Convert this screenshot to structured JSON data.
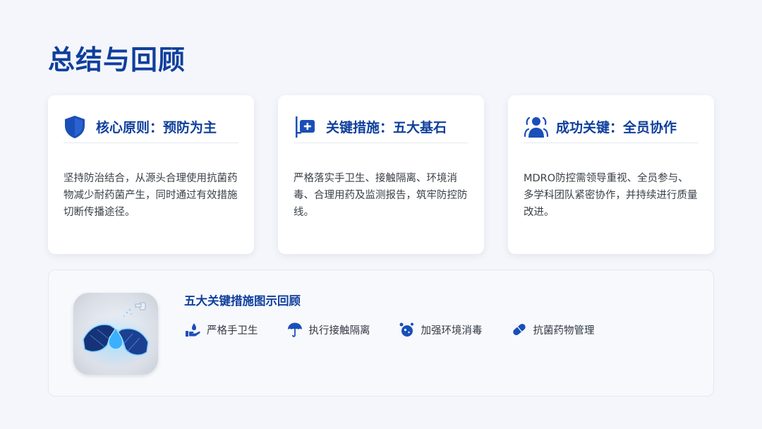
{
  "page": {
    "title": "总结与回顾"
  },
  "cards": [
    {
      "icon": "shield-icon",
      "title": "核心原则：预防为主",
      "body": "坚持防治结合，从源头合理使用抗菌药物减少耐药菌产生，同时通过有效措施切断传播途径。"
    },
    {
      "icon": "medical-kit-icon",
      "title": "关键措施：五大基石",
      "body": "严格落实手卫生、接触隔离、环境消毒、合理用药及监测报告，筑牢防控防线。"
    },
    {
      "icon": "team-icon",
      "title": "成功关键：全员协作",
      "body": "MDRO防控需领导重视、全员参与、多学科团队紧密协作，并持续进行质量改进。"
    }
  ],
  "summary_panel": {
    "image": "handwashing-illustration",
    "title": "五大关键措施图示回顾",
    "measures": [
      {
        "icon": "hand-hygiene-icon",
        "label": "严格手卫生"
      },
      {
        "icon": "umbrella-icon",
        "label": "执行接触隔离"
      },
      {
        "icon": "bacteria-icon",
        "label": "加强环境消毒"
      },
      {
        "icon": "pill-icon",
        "label": "抗菌药物管理"
      }
    ]
  },
  "colors": {
    "primary": "#0f3f9c",
    "accent": "#1a56c4",
    "background": "#f4f6fb",
    "card": "#ffffff"
  }
}
